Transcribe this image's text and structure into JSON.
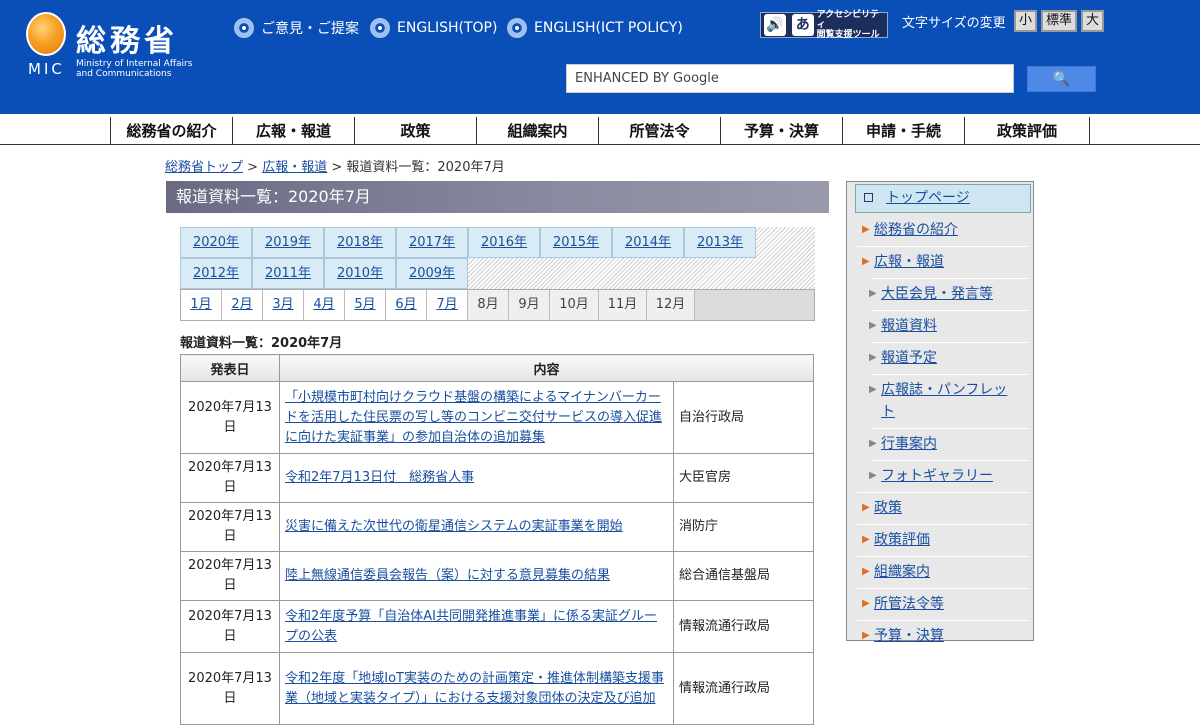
{
  "header": {
    "logo_name": "総務省",
    "logo_abbr": "MIC",
    "logo_en": "Ministry of Internal Affairs\nand Communications",
    "links": [
      "ご意見・ご提案",
      "ENGLISH(TOP)",
      "ENGLISH(ICT POLICY)"
    ],
    "acc_tool_icon": "あ",
    "acc_tool_text": "アクセシビリティ\n閲覧支援ツール",
    "font_size_label": "文字サイズの変更",
    "font_sizes": [
      "小",
      "標準",
      "大"
    ],
    "search_placeholder": "ENHANCED BY Google",
    "search_button": "🔍"
  },
  "gnav": [
    "総務省の紹介",
    "広報・報道",
    "政策",
    "組織案内",
    "所管法令",
    "予算・決算",
    "申請・手続",
    "政策評価"
  ],
  "breadcrumb": {
    "home": "総務省トップ",
    "sep1": " > ",
    "parent": "広報・報道",
    "sep2": " > ",
    "current": "報道資料一覧：2020年7月"
  },
  "page_title": "報道資料一覧：2020年7月",
  "years": [
    "2020年",
    "2019年",
    "2018年",
    "2017年",
    "2016年",
    "2015年",
    "2014年",
    "2013年",
    "2012年",
    "2011年",
    "2010年",
    "2009年"
  ],
  "months": [
    "1月",
    "2月",
    "3月",
    "4月",
    "5月",
    "6月",
    "7月",
    "8月",
    "9月",
    "10月",
    "11月",
    "12月"
  ],
  "sub_title": "報道資料一覧：2020年7月",
  "table": {
    "headers": [
      "発表日",
      "内容"
    ],
    "rows": [
      {
        "date": "2020年7月13日",
        "title": "「小規模市町村向けクラウド基盤の構築によるマイナンバーカードを活用した住民票の写し等のコンビニ交付サービスの導入促進に向けた実証事業」の参加自治体の追加募集",
        "dept": "自治行政局"
      },
      {
        "date": "2020年7月13日",
        "title": "令和2年7月13日付　総務省人事",
        "dept": "大臣官房"
      },
      {
        "date": "2020年7月13日",
        "title": "災害に備えた次世代の衛星通信システムの実証事業を開始",
        "dept": "消防庁"
      },
      {
        "date": "2020年7月13日",
        "title": "陸上無線通信委員会報告（案）に対する意見募集の結果",
        "dept": "総合通信基盤局"
      },
      {
        "date": "2020年7月13日",
        "title": "令和2年度予算「自治体AI共同開発推進事業」に係る実証グループの公表",
        "dept": "情報流通行政局"
      },
      {
        "date": "2020年7月13日",
        "title": "令和2年度「地域IoT実装のための計画策定・推進体制構築支援事業（地域と実装タイプ）」における支援対象団体の決定及び追加",
        "dept": "情報流通行政局"
      }
    ]
  },
  "sidebar": {
    "top": "トップページ",
    "items": [
      "総務省の紹介",
      "広報・報道",
      "大臣会見・発言等",
      "報道資料",
      "報道予定",
      "広報誌・パンフレット",
      "行事案内",
      "フォトギャラリー",
      "政策",
      "政策評価",
      "組織案内",
      "所管法令等",
      "予算・決算"
    ]
  },
  "colors": {
    "header_bg": "#0a4fb8",
    "accent_orange": "#e07020",
    "link": "#1a4fa0"
  }
}
